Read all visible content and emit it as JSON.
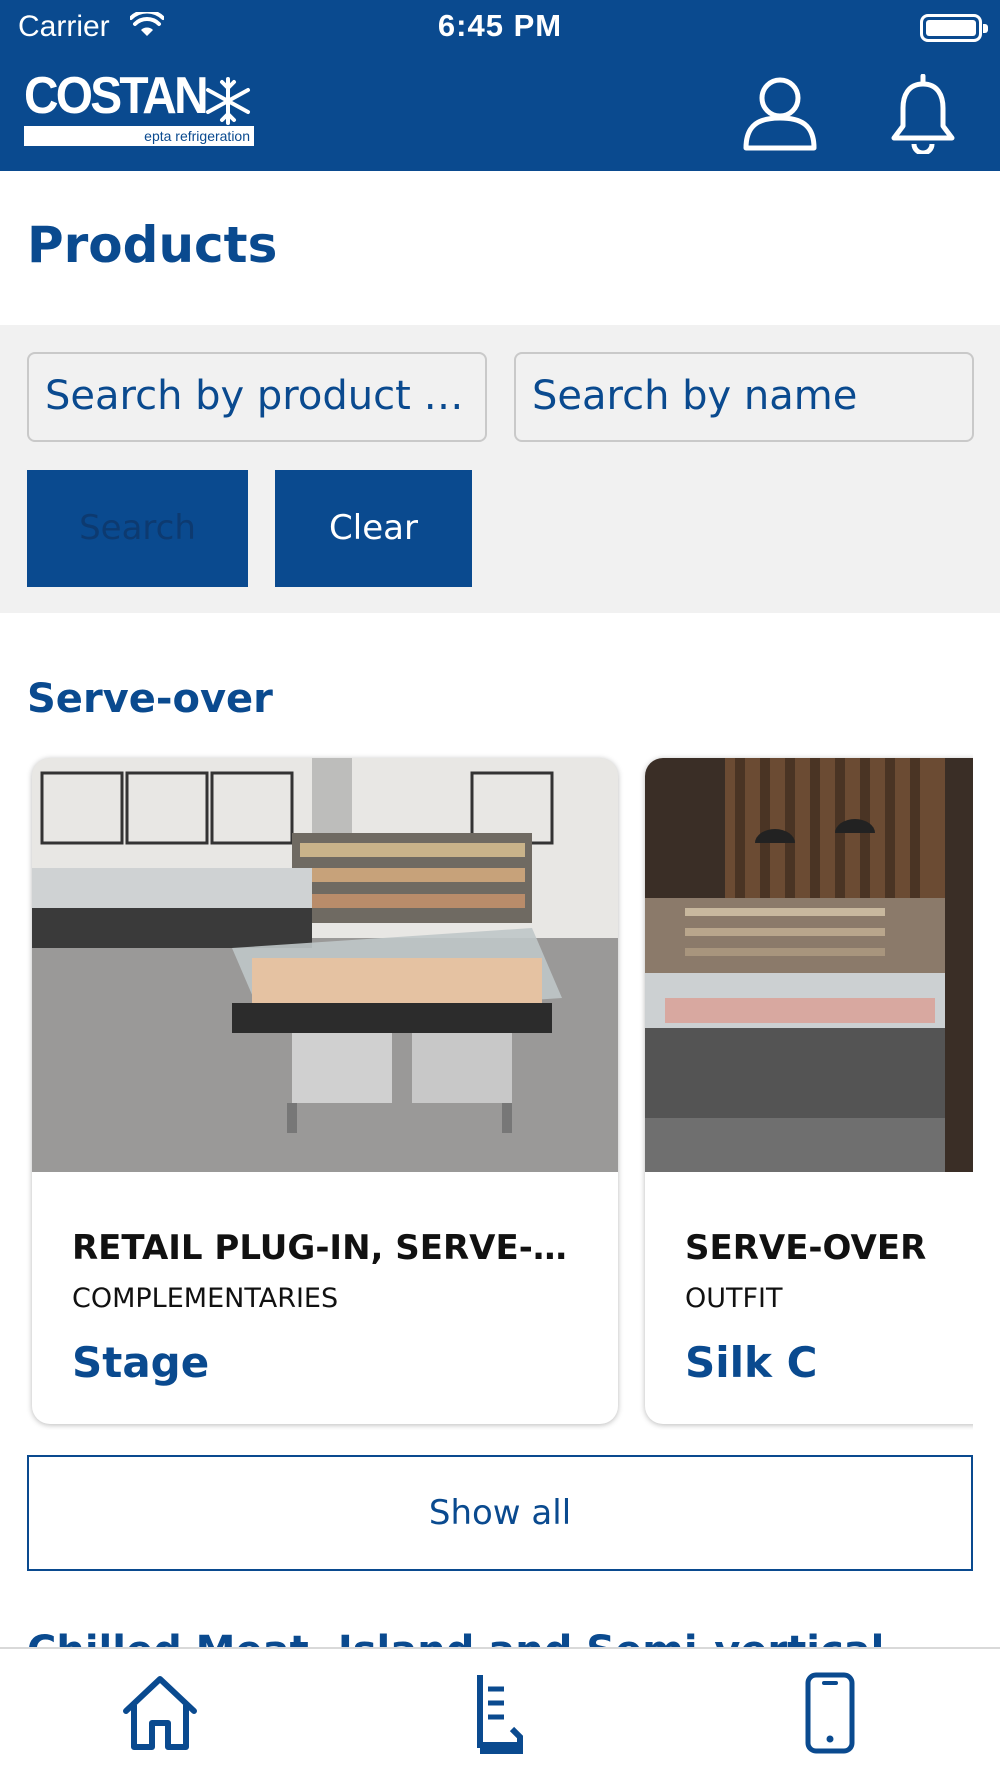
{
  "status_bar": {
    "carrier": "Carrier",
    "time": "6:45 PM"
  },
  "header": {
    "logo_word": "COSTAN",
    "logo_tagline": "epta refrigeration"
  },
  "page": {
    "title": "Products"
  },
  "search": {
    "code_placeholder": "Search by product code",
    "name_placeholder": "Search by name",
    "search_label": "Search",
    "clear_label": "Clear"
  },
  "section": {
    "title": "Serve-over",
    "cards": [
      {
        "category": "RETAIL PLUG-IN, SERVE-OVER",
        "subcategory": "COMPLEMENTARIES",
        "name": "Stage"
      },
      {
        "category": "SERVE-OVER",
        "subcategory": "OUTFIT",
        "name": "Silk C"
      }
    ],
    "show_all_label": "Show all"
  },
  "next_section": {
    "title": "Chilled Meat, Island and Semi-vertical"
  },
  "tabbar": {
    "items": [
      "home-icon",
      "catalog-icon",
      "device-icon"
    ]
  },
  "colors": {
    "brand": "#0a4a8f",
    "panel": "#f1f1f1"
  }
}
